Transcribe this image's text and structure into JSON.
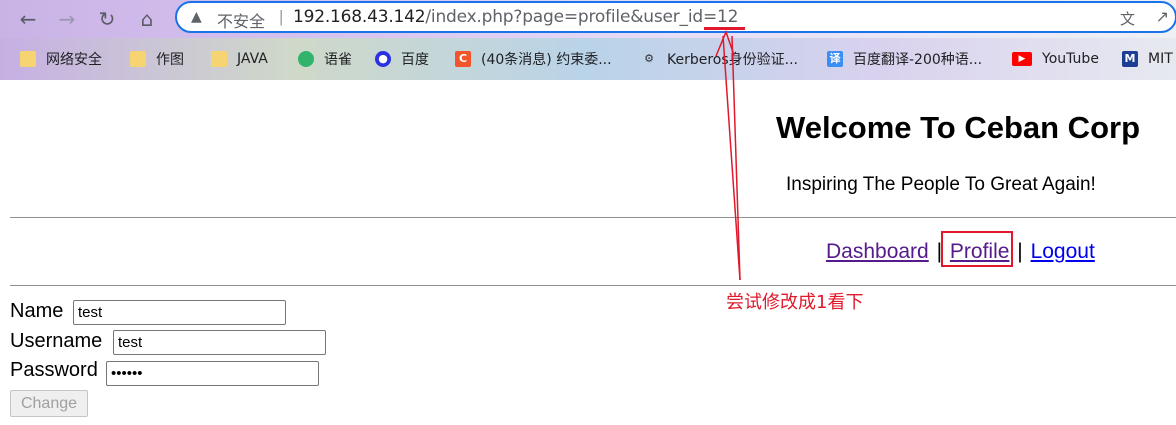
{
  "browser": {
    "nav_icons": [
      "back-arrow-icon",
      "forward-arrow-icon",
      "reload-icon",
      "home-icon"
    ],
    "security_label": "不安全",
    "url_host": "192.168.43.142",
    "url_path": "/index.php?page=profile&user_id=12",
    "bookmarks": [
      {
        "label": "网络安全",
        "icon": "folder-icon"
      },
      {
        "label": "作图",
        "icon": "folder-icon"
      },
      {
        "label": "JAVA",
        "icon": "folder-icon"
      },
      {
        "label": "语雀",
        "icon": "yuque-icon"
      },
      {
        "label": "百度",
        "icon": "baidu-icon"
      },
      {
        "label": "(40条消息) 约束委...",
        "icon": "csdn-icon"
      },
      {
        "label": "Kerberos身份验证...",
        "icon": "kerberos-icon"
      },
      {
        "label": "百度翻译-200种语...",
        "icon": "baidu-translate-icon"
      },
      {
        "label": "YouTube",
        "icon": "youtube-icon"
      },
      {
        "label": "MIT",
        "icon": "mit-icon"
      }
    ]
  },
  "page": {
    "title": "Welcome To Ceban Corp",
    "tagline": "Inspiring The People To Great Again!",
    "nav": {
      "dashboard": "Dashboard",
      "separator": "|",
      "profile": "Profile",
      "logout": "Logout"
    },
    "form": {
      "name_label": "Name",
      "name_value": "test",
      "username_label": "Username",
      "username_value": "test",
      "password_label": "Password",
      "password_value": "••••••",
      "change_button": "Change"
    }
  },
  "annotation": {
    "text": "尝试修改成1看下",
    "color": "#e0192c"
  }
}
